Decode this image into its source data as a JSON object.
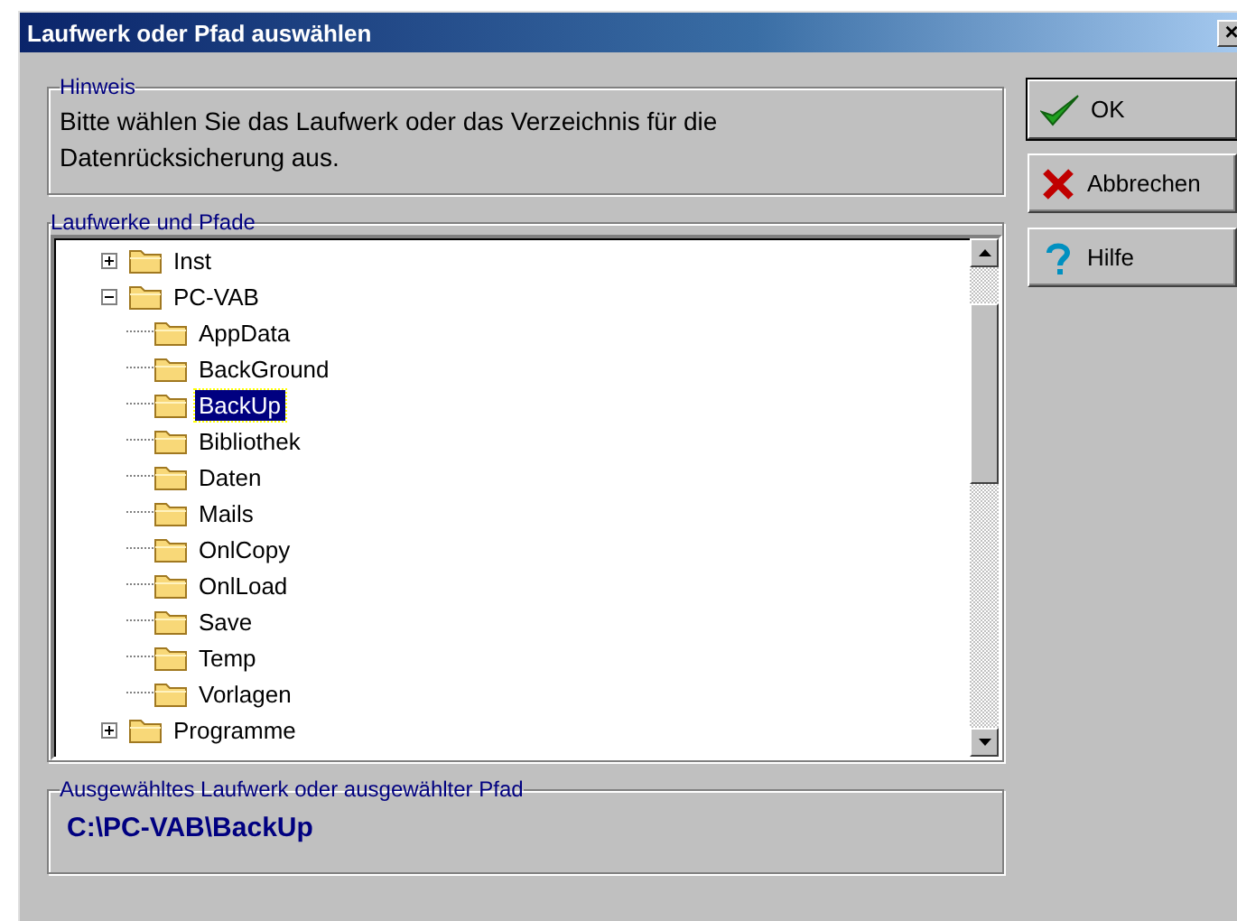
{
  "window": {
    "title": "Laufwerk oder Pfad auswählen",
    "close": "×"
  },
  "hint": {
    "legend": "Hinweis",
    "text": "Bitte wählen Sie das Laufwerk oder das Verzeichnis für die Datenrücksicherung aus."
  },
  "tree": {
    "legend": "Laufwerke und Pfade",
    "items": [
      {
        "label": "Inst",
        "expanded": false,
        "selected": false
      },
      {
        "label": "PC-VAB",
        "expanded": true,
        "selected": false,
        "children": [
          {
            "label": "AppData",
            "selected": false
          },
          {
            "label": "BackGround",
            "selected": false
          },
          {
            "label": "BackUp",
            "selected": true
          },
          {
            "label": "Bibliothek",
            "selected": false
          },
          {
            "label": "Daten",
            "selected": false
          },
          {
            "label": "Mails",
            "selected": false
          },
          {
            "label": "OnlCopy",
            "selected": false
          },
          {
            "label": "OnlLoad",
            "selected": false
          },
          {
            "label": "Save",
            "selected": false
          },
          {
            "label": "Temp",
            "selected": false
          },
          {
            "label": "Vorlagen",
            "selected": false
          }
        ]
      },
      {
        "label": "Programme",
        "expanded": false,
        "selected": false
      }
    ]
  },
  "selection": {
    "legend": "Ausgewähltes Laufwerk oder ausgewählter Pfad",
    "value": "C:\\PC-VAB\\BackUp"
  },
  "buttons": [
    {
      "kind": "ok",
      "label": "OK"
    },
    {
      "kind": "cancel",
      "label": "Abbrechen"
    },
    {
      "kind": "help",
      "label": "Hilfe"
    }
  ]
}
